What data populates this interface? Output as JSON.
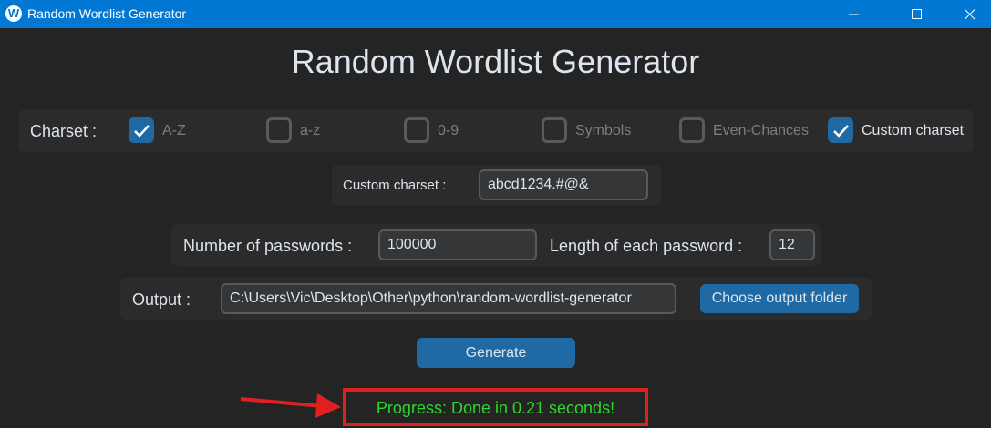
{
  "window": {
    "title": "Random Wordlist Generator",
    "app_icon_letter": "W",
    "controls": [
      "minimize-icon",
      "maximize-icon",
      "close-icon"
    ]
  },
  "heading": "Random Wordlist Generator",
  "charset": {
    "label": "Charset :",
    "options": [
      {
        "label": "A-Z",
        "checked": true
      },
      {
        "label": "a-z",
        "checked": false
      },
      {
        "label": "0-9",
        "checked": false
      },
      {
        "label": "Symbols",
        "checked": false
      },
      {
        "label": "Even-Chances",
        "checked": false
      },
      {
        "label": "Custom charset",
        "checked": true
      }
    ]
  },
  "custom_charset": {
    "label": "Custom charset :",
    "value": "abcd1234.#@&"
  },
  "passwords": {
    "count_label": "Number of passwords :",
    "count_value": "100000",
    "length_label": "Length of each password :",
    "length_value": "12"
  },
  "output": {
    "label": "Output :",
    "path": "C:\\Users\\Vic\\Desktop\\Other\\python\\random-wordlist-generator",
    "choose_button": "Choose output folder"
  },
  "generate_button": "Generate",
  "progress_text": "Progress: Done in 0.21 seconds!",
  "colors": {
    "titlebar": "#0078d4",
    "background": "#242424",
    "panel": "#2b2b2b",
    "accent": "#1f6aa5",
    "progress_text": "#2bd92b",
    "highlight_box": "#e02020"
  }
}
